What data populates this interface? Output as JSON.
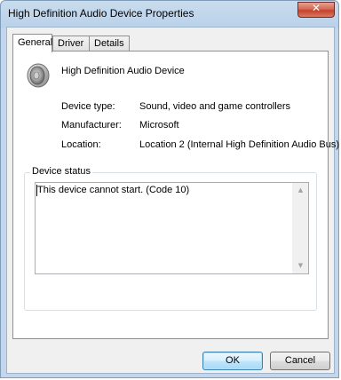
{
  "window": {
    "title": "High Definition Audio Device Properties",
    "close_glyph": "✕"
  },
  "tabs": [
    {
      "label": "General",
      "active": true
    },
    {
      "label": "Driver",
      "active": false
    },
    {
      "label": "Details",
      "active": false
    }
  ],
  "device": {
    "icon": "speaker-icon",
    "name": "High Definition Audio Device",
    "properties": [
      {
        "label": "Device type:",
        "value": "Sound, video and game controllers"
      },
      {
        "label": "Manufacturer:",
        "value": "Microsoft"
      },
      {
        "label": "Location:",
        "value": "Location 2 (Internal High Definition Audio Bus)"
      }
    ]
  },
  "status": {
    "group_label": "Device status",
    "text": "This device cannot start. (Code 10)",
    "scroll_up_glyph": "▲",
    "scroll_down_glyph": "▼"
  },
  "buttons": {
    "ok": "OK",
    "cancel": "Cancel"
  }
}
